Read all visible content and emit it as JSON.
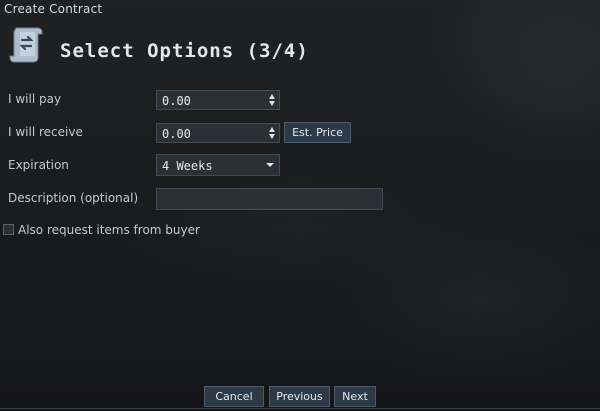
{
  "window": {
    "title": "Create Contract"
  },
  "header": {
    "heading": "Select Options (3/4)",
    "icon": "contract-scroll-icon"
  },
  "form": {
    "pay": {
      "label": "I will pay",
      "value": "0.00"
    },
    "receive": {
      "label": "I will receive",
      "value": "0.00",
      "est_price_label": "Est. Price"
    },
    "expiration": {
      "label": "Expiration",
      "value": "4 Weeks"
    },
    "description": {
      "label": "Description (optional)",
      "value": ""
    },
    "request_items": {
      "label": "Also request items from buyer",
      "checked": false
    }
  },
  "footer": {
    "cancel_label": "Cancel",
    "previous_label": "Previous",
    "next_label": "Next"
  }
}
